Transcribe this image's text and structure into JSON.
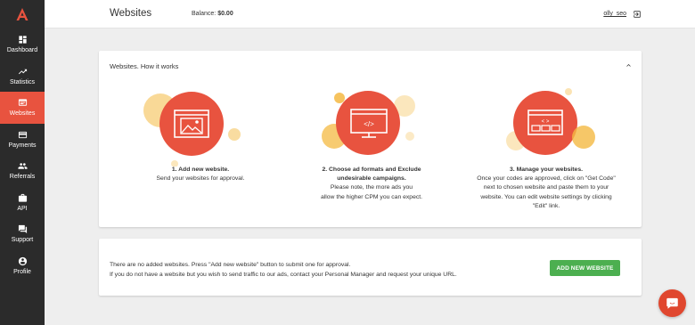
{
  "colors": {
    "accent": "#e8533f",
    "sidebar_bg": "#2b2b2b",
    "button_green": "#4caf50",
    "illustration_orange": "#f4b942"
  },
  "sidebar": {
    "logo_icon": "a-logo-icon",
    "items": [
      {
        "label": "Dashboard",
        "icon": "dashboard-icon",
        "active": false
      },
      {
        "label": "Statistics",
        "icon": "trend-chart-icon",
        "active": false
      },
      {
        "label": "Websites",
        "icon": "website-icon",
        "active": true
      },
      {
        "label": "Payments",
        "icon": "credit-card-icon",
        "active": false
      },
      {
        "label": "Referrals",
        "icon": "people-icon",
        "active": false
      },
      {
        "label": "API",
        "icon": "briefcase-icon",
        "active": false
      },
      {
        "label": "Support",
        "icon": "chat-icon",
        "active": false
      },
      {
        "label": "Profile",
        "icon": "account-icon",
        "active": false
      }
    ]
  },
  "header": {
    "title": "Websites",
    "balance_label": "Balance:",
    "balance_value": "$0.00",
    "username": "olly_seo",
    "logout_icon": "logout-icon"
  },
  "how_it_works": {
    "title": "Websites. How it works",
    "toggle_icon": "chevron-up-icon",
    "steps": [
      {
        "title": "1. Add new website.",
        "body": "Send your websites for approval.",
        "icon": "image-window-icon"
      },
      {
        "title": "2. Choose ad formats and Exclude\nundesirable campaigns.",
        "body": "Please note, the more ads you\nallow the higher CPM you can expect.",
        "icon": "code-monitor-icon"
      },
      {
        "title": "3. Manage your websites.",
        "body": "Once your codes are approved, click on \"Get Code\"\nnext to chosen website and paste them to your\nwebsite. You can edit website settings by clicking\n\"Edit\" link.",
        "icon": "code-layout-window-icon"
      }
    ]
  },
  "empty_state": {
    "line1": "There are no added websites. Press \"Add new website\" button to submit one for approval.",
    "line2": "If you do not have a website but you wish to send traffic to our ads, contact your Personal Manager and request your unique URL.",
    "button_label": "ADD NEW WEBSITE"
  },
  "chat_widget": {
    "icon": "chat-bubble-icon"
  }
}
